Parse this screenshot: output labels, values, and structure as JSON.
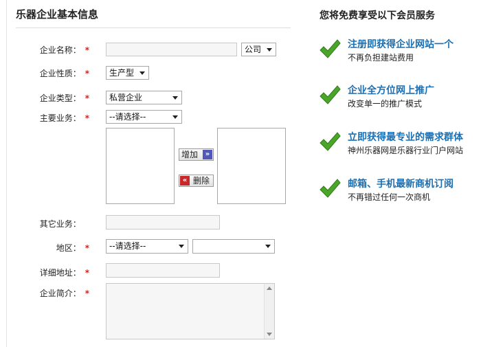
{
  "form": {
    "title": "乐器企业基本信息",
    "required_mark": "*",
    "name_label": "企业名称：",
    "name_value": "",
    "name_suffix": "公司",
    "nature_label": "企业性质：",
    "nature_value": "生产型",
    "type_label": "企业类型：",
    "type_value": "私营企业",
    "business_label": "主要业务：",
    "business_value": "--请选择--",
    "add_label": "增加",
    "add_icon": "»",
    "delete_label": "删除",
    "delete_icon": "«",
    "other_label": "其它业务：",
    "region_label": "地区：",
    "region_value": "--请选择--",
    "region_sub_value": "",
    "address_label": "详细地址：",
    "intro_label": "企业简介："
  },
  "sidebar": {
    "headline": "您将免费享受以下会员服务",
    "benefits": [
      {
        "title": "注册即获得企业网站一个",
        "desc": "不再负担建站费用"
      },
      {
        "title": "企业全方位网上推广",
        "desc": "改变单一的推广模式"
      },
      {
        "title": "立即获得最专业的需求群体",
        "desc": "神州乐器网是乐器行业门户网站"
      },
      {
        "title": "邮箱、手机最新商机订阅",
        "desc": "不再错过任何一次商机"
      }
    ]
  },
  "colors": {
    "accent_blue": "#1a6fb3",
    "check_green": "#4aa52a",
    "required_red": "#d42020"
  }
}
